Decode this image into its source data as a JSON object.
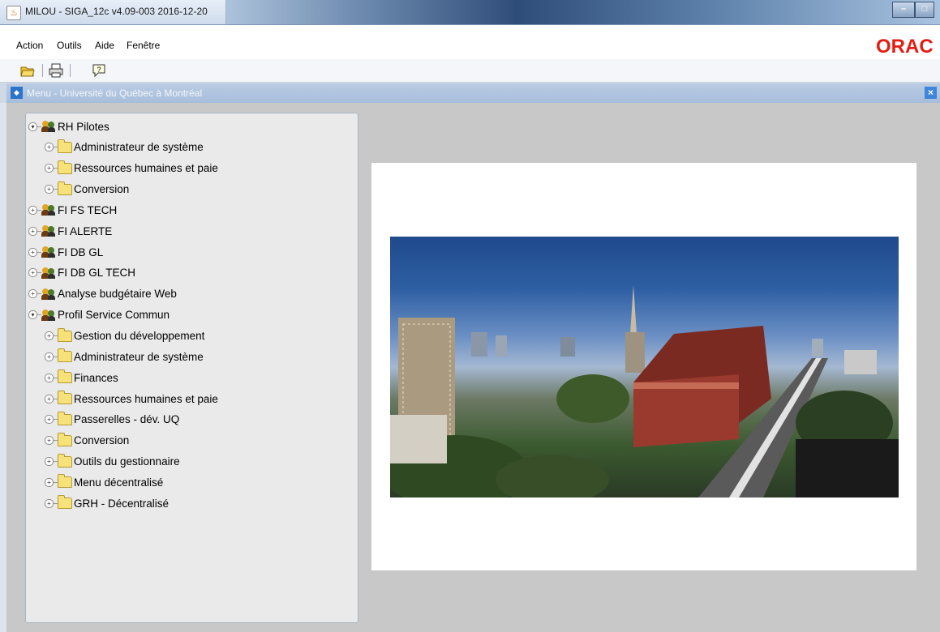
{
  "window": {
    "title": "MILOU - SIGA_12c v4.09-003 2016-12-20",
    "app_icon": "java-cup-icon"
  },
  "menubar": {
    "items": [
      "Action",
      "Outils",
      "Aide",
      "Fenêtre"
    ],
    "brand": "ORAC"
  },
  "toolbar": {
    "icons": [
      "open-folder-icon",
      "print-icon",
      "help-icon"
    ]
  },
  "inner_window": {
    "title": "Menu - Université du Québec à Montréal",
    "close_glyph": "×"
  },
  "tree": [
    {
      "label": "RH Pilotes",
      "type": "role",
      "level": 0,
      "expanded": true
    },
    {
      "label": "Administrateur de système",
      "type": "folder",
      "level": 1,
      "expanded": false
    },
    {
      "label": "Ressources humaines et paie",
      "type": "folder",
      "level": 1,
      "expanded": false
    },
    {
      "label": "Conversion",
      "type": "folder",
      "level": 1,
      "expanded": false
    },
    {
      "label": "FI FS TECH",
      "type": "role",
      "level": 0,
      "expanded": false
    },
    {
      "label": "FI ALERTE",
      "type": "role",
      "level": 0,
      "expanded": false
    },
    {
      "label": "FI DB GL",
      "type": "role",
      "level": 0,
      "expanded": false
    },
    {
      "label": "FI DB GL TECH",
      "type": "role",
      "level": 0,
      "expanded": false
    },
    {
      "label": "Analyse budgétaire Web",
      "type": "role",
      "level": 0,
      "expanded": false
    },
    {
      "label": "Profil Service Commun",
      "type": "role",
      "level": 0,
      "expanded": true
    },
    {
      "label": "Gestion du développement",
      "type": "folder",
      "level": 1,
      "expanded": false
    },
    {
      "label": "Administrateur de système",
      "type": "folder",
      "level": 1,
      "expanded": false
    },
    {
      "label": "Finances",
      "type": "folder",
      "level": 1,
      "expanded": false
    },
    {
      "label": "Ressources humaines et paie",
      "type": "folder",
      "level": 1,
      "expanded": false
    },
    {
      "label": "Passerelles - dév. UQ",
      "type": "folder",
      "level": 1,
      "expanded": false
    },
    {
      "label": "Conversion",
      "type": "folder",
      "level": 1,
      "expanded": false
    },
    {
      "label": "Outils du gestionnaire",
      "type": "folder",
      "level": 1,
      "expanded": false
    },
    {
      "label": "Menu décentralisé",
      "type": "folder",
      "level": 1,
      "expanded": false
    },
    {
      "label": "GRH - Décentralisé",
      "type": "folder",
      "level": 1,
      "expanded": false
    }
  ],
  "colors": {
    "oracle_red": "#e21d14",
    "inner_title_bg": "#b0c5df",
    "workspace_bg": "#c8c8c8"
  }
}
